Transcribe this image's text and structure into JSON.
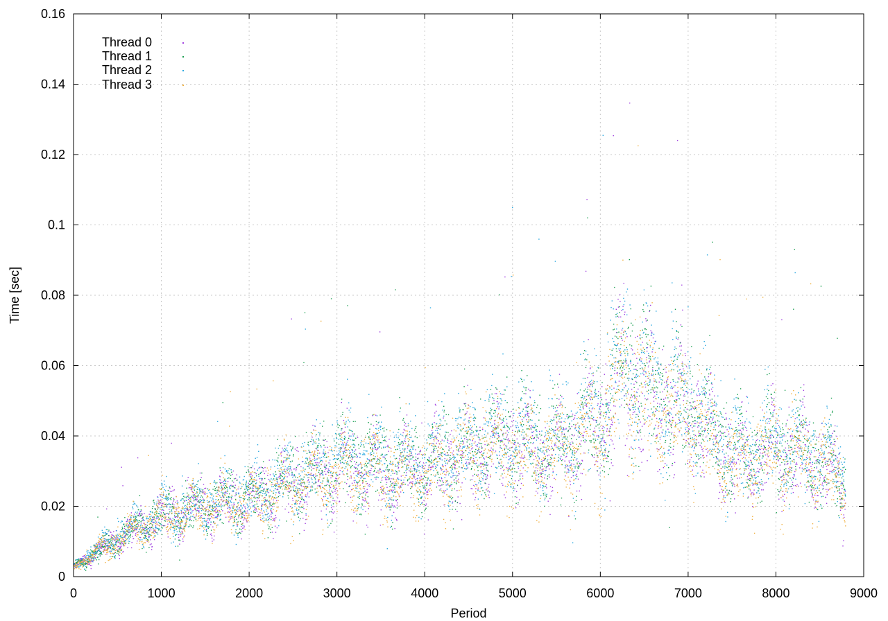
{
  "chart_data": {
    "type": "scatter",
    "title": "",
    "xlabel": "Period",
    "ylabel": "Time [sec]",
    "xlim": [
      0,
      9000
    ],
    "ylim": [
      0,
      0.16
    ],
    "x_ticks": [
      0,
      1000,
      2000,
      3000,
      4000,
      5000,
      6000,
      7000,
      8000,
      9000
    ],
    "y_ticks": [
      "0",
      "0.02",
      "0.04",
      "0.06",
      "0.08",
      "0.1",
      "0.12",
      "0.14",
      "0.16"
    ],
    "y_tick_values": [
      0,
      0.02,
      0.04,
      0.06,
      0.08,
      0.1,
      0.12,
      0.14,
      0.16
    ],
    "grid": true,
    "legend_position": "top-left",
    "series": [
      {
        "name": "Thread 0",
        "color": "#a040e0",
        "trend_x": [
          0,
          500,
          1000,
          1500,
          2000,
          2500,
          3000,
          3500,
          4000,
          4500,
          5000,
          5500,
          6000,
          6300,
          6600,
          7000,
          7500,
          8000,
          8500,
          8800
        ],
        "trend_y": [
          0.003,
          0.011,
          0.017,
          0.02,
          0.022,
          0.027,
          0.031,
          0.03,
          0.03,
          0.035,
          0.038,
          0.035,
          0.045,
          0.058,
          0.05,
          0.048,
          0.033,
          0.036,
          0.033,
          0.025
        ]
      },
      {
        "name": "Thread 1",
        "color": "#1a9e50",
        "trend_x": [
          0,
          500,
          1000,
          1500,
          2000,
          2500,
          3000,
          3500,
          4000,
          4500,
          5000,
          5500,
          6000,
          6300,
          6600,
          7000,
          7500,
          8000,
          8500,
          8800
        ],
        "trend_y": [
          0.003,
          0.011,
          0.017,
          0.021,
          0.023,
          0.028,
          0.033,
          0.032,
          0.032,
          0.037,
          0.04,
          0.037,
          0.047,
          0.06,
          0.052,
          0.05,
          0.035,
          0.038,
          0.034,
          0.026
        ]
      },
      {
        "name": "Thread 2",
        "color": "#2aa8e0",
        "trend_x": [
          0,
          500,
          1000,
          1500,
          2000,
          2500,
          3000,
          3500,
          4000,
          4500,
          5000,
          5500,
          6000,
          6300,
          6600,
          7000,
          7500,
          8000,
          8500,
          8800
        ],
        "trend_y": [
          0.003,
          0.012,
          0.018,
          0.021,
          0.023,
          0.029,
          0.034,
          0.033,
          0.033,
          0.038,
          0.041,
          0.038,
          0.048,
          0.062,
          0.053,
          0.051,
          0.036,
          0.039,
          0.035,
          0.027
        ]
      },
      {
        "name": "Thread 3",
        "color": "#f0b040",
        "trend_x": [
          0,
          500,
          1000,
          1500,
          2000,
          2500,
          3000,
          3500,
          4000,
          4500,
          5000,
          5500,
          6000,
          6300,
          6600,
          7000,
          7500,
          8000,
          8500,
          8800
        ],
        "trend_y": [
          0.003,
          0.011,
          0.017,
          0.02,
          0.021,
          0.026,
          0.03,
          0.03,
          0.029,
          0.036,
          0.037,
          0.034,
          0.044,
          0.058,
          0.048,
          0.046,
          0.031,
          0.035,
          0.032,
          0.025
        ]
      }
    ]
  }
}
